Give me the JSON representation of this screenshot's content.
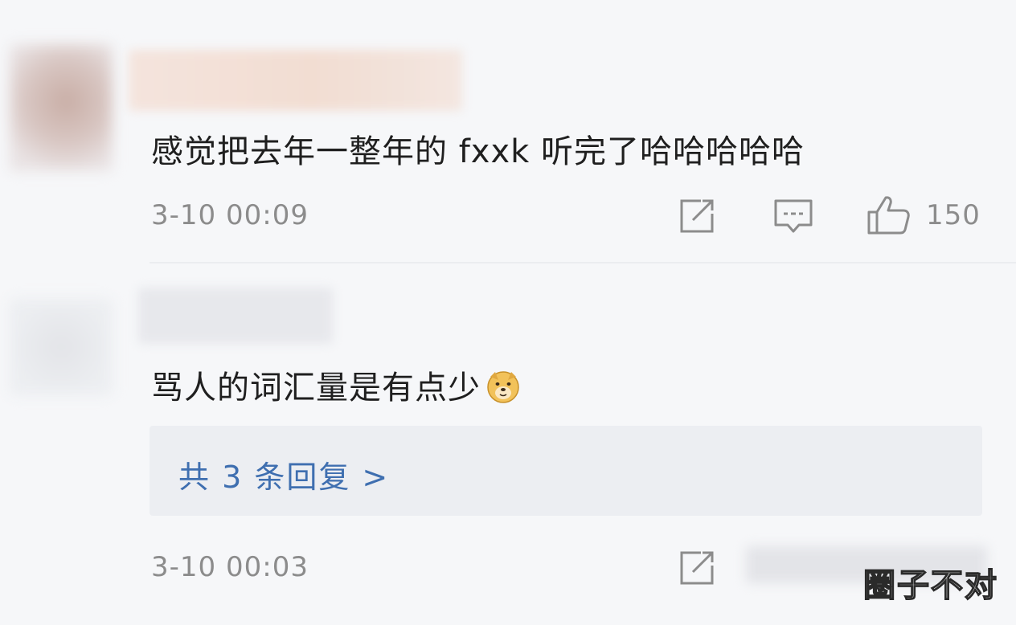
{
  "comments": [
    {
      "text": "感觉把去年一整年的 fxxk 听完了哈哈哈哈哈",
      "timestamp": "3-10 00:09",
      "like_count": "150",
      "actions": [
        "share-icon",
        "comment-icon",
        "thumbs-up-icon"
      ]
    },
    {
      "text": "骂人的词汇量是有点少",
      "emoji": "doge-emoji",
      "timestamp": "3-10 00:03",
      "replies_label": "共 3 条回复 >",
      "actions": [
        "share-icon"
      ]
    }
  ],
  "watermark": "圈子不对",
  "colors": {
    "background": "#f6f7f9",
    "text": "#1f1f1f",
    "meta": "#8c8c8c",
    "link": "#3f6fb0",
    "reply_box": "#eceef2"
  }
}
